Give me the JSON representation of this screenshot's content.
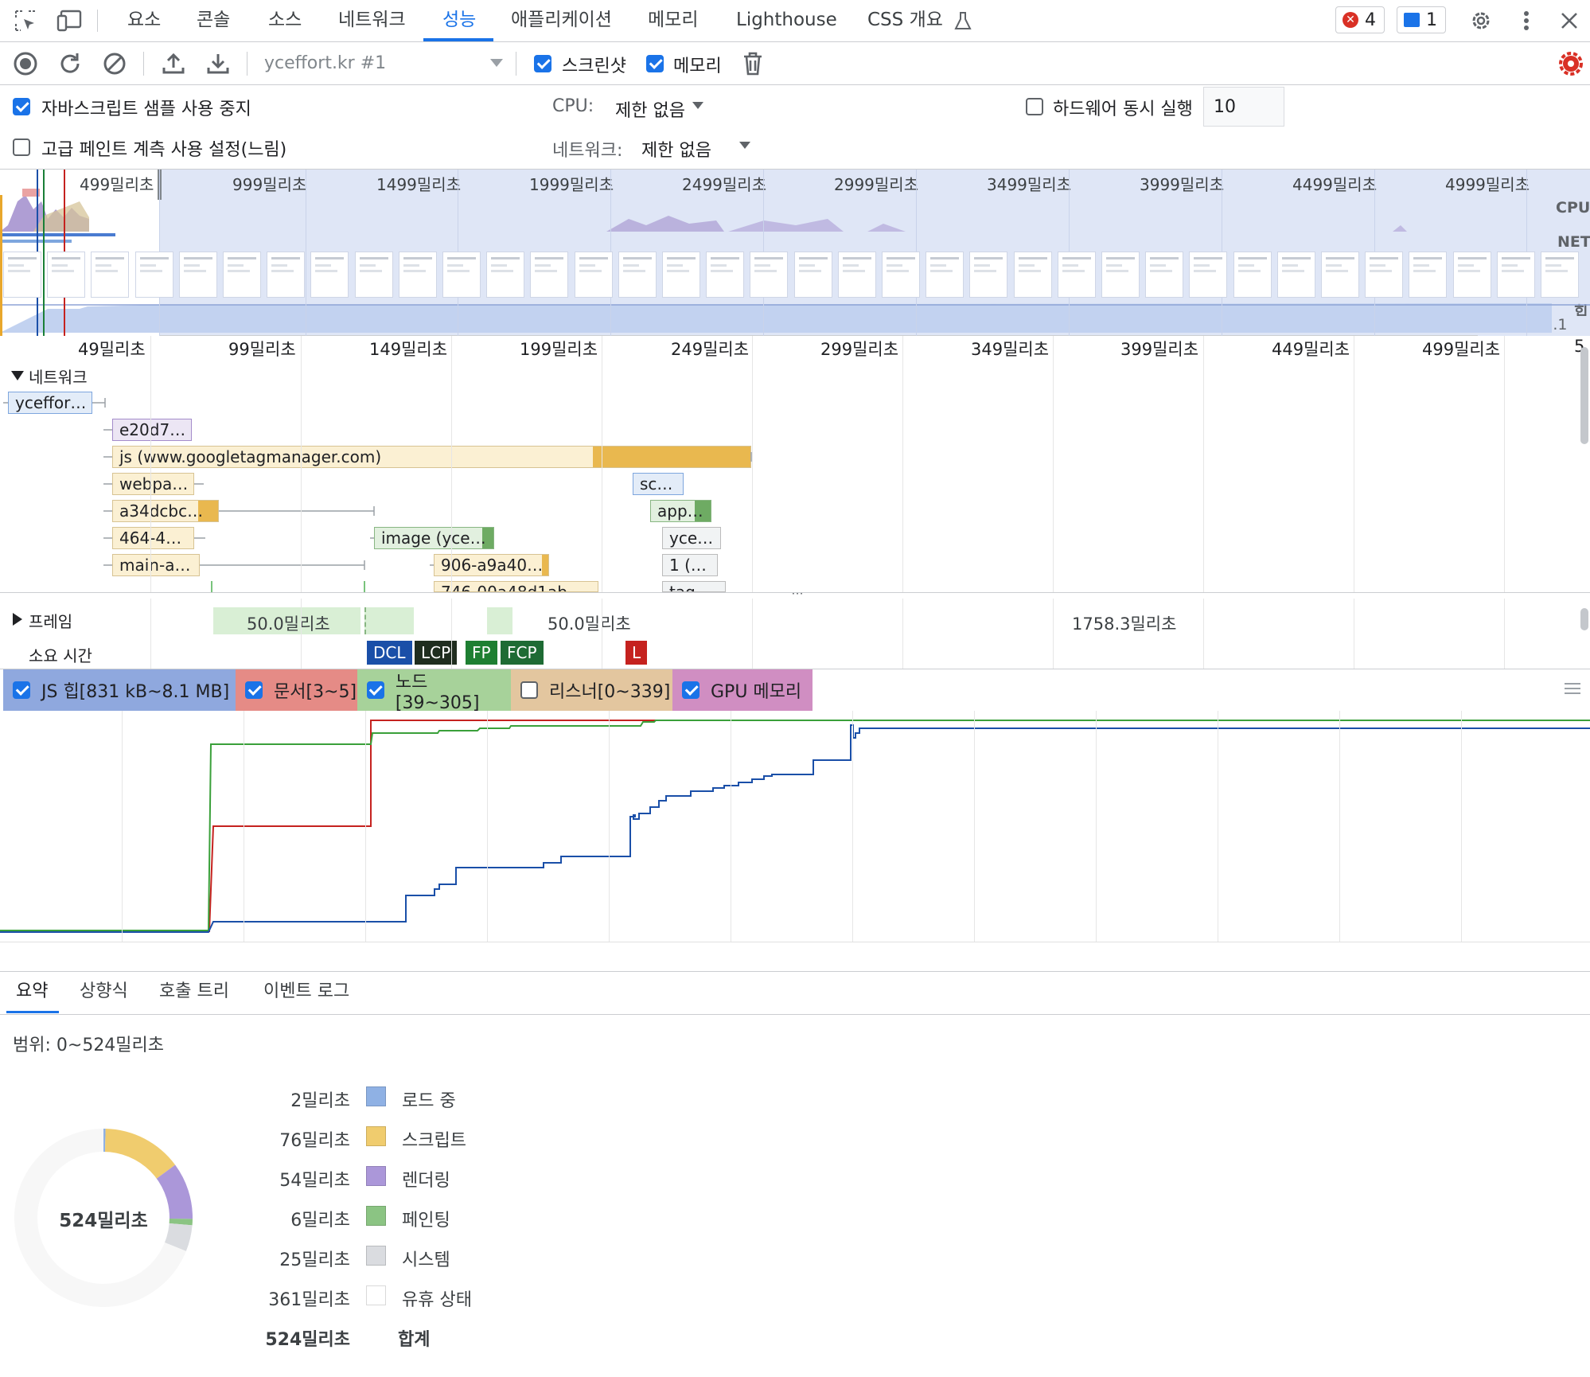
{
  "panel_tabs": [
    "요소",
    "콘솔",
    "소스",
    "네트워크",
    "성능",
    "애플리케이션",
    "메모리",
    "Lighthouse",
    "CSS 개요"
  ],
  "active_tab": "성능",
  "badges": {
    "errors": "4",
    "messages": "1"
  },
  "toolbar": {
    "profile_select": "yceffort.kr #1",
    "screenshots_label": "스크린샷",
    "memory_label": "메모리"
  },
  "settings": {
    "disable_js_samples": "자바스크립트 샘플 사용 중지",
    "advanced_paint": "고급 페인트 계측 사용 설정(느림)",
    "cpu_label": "CPU:",
    "cpu_value": "제한 없음",
    "network_label": "네트워크:",
    "network_value": "제한 없음",
    "hw_concurrency_label": "하드웨어 동시 실행",
    "hw_concurrency_value": "10"
  },
  "overview": {
    "ticks": [
      "499밀리초",
      "999밀리초",
      "1499밀리초",
      "1999밀리초",
      "2499밀리초",
      "2999밀리초",
      "3499밀리초",
      "3999밀리초",
      "4499밀리초",
      "4999밀리초"
    ],
    "cpu_label": "CPU",
    "net_label": "NET",
    "heap_label": "힙",
    "heap_range": "831 kB~8.1 MB"
  },
  "timeline": {
    "ticks": [
      "49밀리초",
      "99밀리초",
      "149밀리초",
      "199밀리초",
      "249밀리초",
      "299밀리초",
      "349밀리초",
      "399밀리초",
      "449밀리초",
      "499밀리초",
      "5"
    ]
  },
  "network": {
    "title": "네트워크",
    "requests": [
      "yceffor…",
      "e20d7…",
      "js (www.googletagmanager.com)",
      "webpa…",
      "a34dcbc…",
      "464-4…",
      "main-a…",
      "image (yce…",
      "906-a9a40…",
      "746-00a48d1ab",
      "sc…",
      "app…",
      "yce…",
      "1 (…",
      "tag"
    ]
  },
  "frames": {
    "label": "프레임",
    "durations": [
      "50.0밀리초",
      "50.0밀리초",
      "1758.3밀리초"
    ]
  },
  "timings": {
    "label": "소요 시간",
    "markers": [
      "DCL",
      "LCP",
      "FP",
      "FCP",
      "L"
    ]
  },
  "memory_legend": [
    {
      "label": "JS 힙[831 kB~8.1 MB]",
      "color": "#8fa8de"
    },
    {
      "label": "문서[3~5]",
      "color": "#e58b86"
    },
    {
      "label": "노드[39~305]",
      "color": "#a7d29a"
    },
    {
      "label": "리스너[0~339]",
      "color": "#e3c69f"
    },
    {
      "label": "GPU 메모리",
      "color": "#d08ec2"
    }
  ],
  "bottom_tabs": [
    "요약",
    "상향식",
    "호출 트리",
    "이벤트 로그"
  ],
  "summary": {
    "range": "범위: 0~524밀리초",
    "total_center": "524밀리초",
    "rows": [
      {
        "value": "2밀리초",
        "label": "로드 중",
        "color": "#8fb1e4",
        "ms": 2
      },
      {
        "value": "76밀리초",
        "label": "스크립트",
        "color": "#f0cc6e",
        "ms": 76
      },
      {
        "value": "54밀리초",
        "label": "렌더링",
        "color": "#ab97d9",
        "ms": 54
      },
      {
        "value": "6밀리초",
        "label": "페인팅",
        "color": "#8bc483",
        "ms": 6
      },
      {
        "value": "25밀리초",
        "label": "시스템",
        "color": "#dadce0",
        "ms": 25
      },
      {
        "value": "361밀리초",
        "label": "유휴 상태",
        "color": "#ffffff",
        "ms": 361
      }
    ],
    "total_value": "524밀리초",
    "total_label": "합계"
  }
}
